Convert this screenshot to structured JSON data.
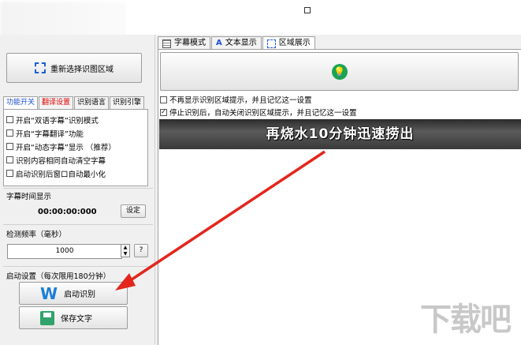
{
  "window": {
    "maximize_icon": "maximize-icon"
  },
  "left": {
    "reselect_label": "重新选择识图区域",
    "tabs": [
      "功能开关",
      "翻译设置",
      "识别语言",
      "识别引擎"
    ],
    "options": [
      {
        "label": "开启“双语字幕”识别模式",
        "checked": false
      },
      {
        "label": "开启“字幕翻译”功能",
        "checked": false
      },
      {
        "label": "开启“动态字幕”显示  （推荐）",
        "checked": false
      },
      {
        "label": "识别内容相同自动清空字幕",
        "checked": false
      },
      {
        "label": "启动识别后窗口自动最小化",
        "checked": false
      }
    ],
    "time_group": "字幕时间显示",
    "time_value": "00:00:00:000",
    "time_set_btn": "设定",
    "freq_group": "检测频率（毫秒）",
    "freq_value": "1000",
    "help_btn": "?",
    "launch_group": "启动设置（每次限用180分钟）",
    "start_btn": "启动识别",
    "save_btn": "保存文字"
  },
  "right": {
    "tabs": [
      {
        "label": "字幕模式",
        "icon": "table-icon"
      },
      {
        "label": "文本显示",
        "icon": "text-icon"
      },
      {
        "label": "区域展示",
        "icon": "region-icon"
      }
    ],
    "chk1": {
      "label": "不再显示识别区域提示，并且记忆这一设置",
      "checked": false
    },
    "chk2": {
      "label": "停止识别后，自动关闭识别区域提示，并且记忆这一设置",
      "checked": true
    },
    "preview_text": "再烧水10分钟迅速捞出"
  },
  "watermark": "下载吧",
  "colors": {
    "accent_red": "#e00000",
    "accent_blue": "#1d4fd0",
    "bulb_green": "#1aa454",
    "arrow_red": "#e3261c"
  }
}
